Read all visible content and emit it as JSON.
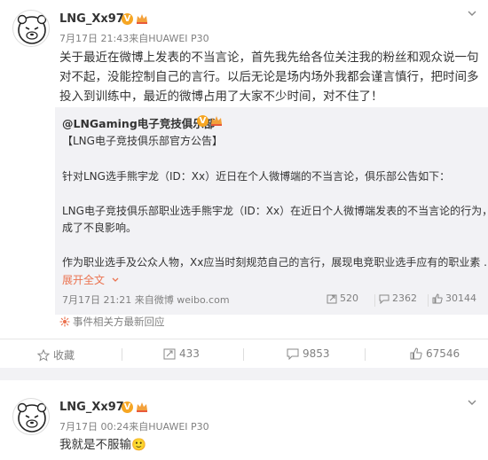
{
  "post1": {
    "username": "LNG_Xx97",
    "verified_badge": "V",
    "time": "7月17日 21:43",
    "source_prefix": "来自",
    "source": "HUAWEI P30",
    "lines": [
      "关于最近在微博上发表的不当言论，首先我先给各位关注我的粉丝和观众说一句",
      "对不起，没能控制自己的言行。以后无论是场内场外我都会谨言慎行，把时间多",
      "投入到训练中，最近的微博占用了大家不少时间，对不住了！"
    ],
    "repost": {
      "username": "@LNGaming电子竞技俱乐部",
      "verified_badge": "V",
      "lines": [
        "【LNG电子竞技俱乐部官方公告】",
        "针对LNG选手熊宇龙（ID：Xx）近日在个人微博端的不当言论，俱乐部公告如下：",
        "LNG电子竞技俱乐部职业选手熊宇龙（ID：Xx）在近日个人微博端发表的不当言论的行为，造",
        "成了不良影响。",
        "作为职业选手及公众人物，Xx应当时刻规范自己的言行，展现电竞职业选手应有的职业素 ..."
      ],
      "expand_label": "展开全文",
      "time": "7月17日 21:21",
      "source_prefix": "来自",
      "source": "微博 weibo.com",
      "stats": {
        "shares": "520",
        "comments": "2362",
        "likes": "30144"
      }
    },
    "related_label": "事件相关方最新回应",
    "actions": {
      "favorite": "收藏",
      "share": "433",
      "comment": "9853",
      "like": "67546"
    }
  },
  "post2": {
    "username": "LNG_Xx97",
    "verified_badge": "V",
    "time": "7月17日 00:24",
    "source_prefix": "来自",
    "source": "HUAWEI P30",
    "text": "我就是不服输",
    "emoji": "🙂"
  },
  "colors": {
    "accent": "#eb7350",
    "badge": "#f6a623",
    "muted": "#808080"
  }
}
